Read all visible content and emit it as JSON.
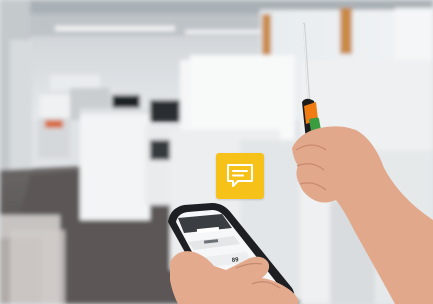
{
  "scene": {
    "icons": [
      "message-icon"
    ],
    "colors": {
      "badge": "#f6c21a",
      "probe_orange": "#f07c12",
      "probe_dark": "#1c1c1c",
      "probe_green": "#3a9b3f",
      "phone_app_accent": "#f07c12"
    }
  }
}
